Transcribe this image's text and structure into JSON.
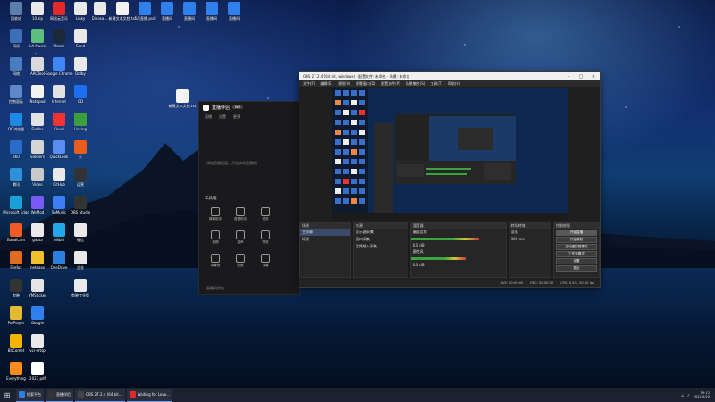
{
  "desktop": {
    "icons_col1": [
      {
        "label": "回收站",
        "color": "#5a7fa8"
      },
      {
        "label": "网易",
        "color": "#3d6fb8"
      },
      {
        "label": "网络",
        "color": "#4c7cc0"
      },
      {
        "label": "控制面板",
        "color": "#5d8ac7"
      },
      {
        "label": "QQ浏览器",
        "color": "#1e88e5"
      },
      {
        "label": "360",
        "color": "#2c6cc9"
      },
      {
        "label": "腾讯",
        "color": "#2f8fd8"
      },
      {
        "label": "Microsoft Edge",
        "color": "#1aa1d9"
      },
      {
        "label": "Bandicam",
        "color": "#f05a24"
      },
      {
        "label": "Firefox",
        "color": "#e26a1f"
      },
      {
        "label": "剪映",
        "color": "#333333"
      },
      {
        "label": "PotPlayer",
        "color": "#e4b830"
      },
      {
        "label": "BitComet",
        "color": "#f4b400"
      },
      {
        "label": "Everything",
        "color": "#ff8c1a"
      }
    ],
    "icons_col2": [
      {
        "label": "10.zip",
        "color": "#e9e9e9"
      },
      {
        "label": "LX Music",
        "color": "#5cbf7c"
      },
      {
        "label": "ARCTool",
        "color": "#d9d9d9"
      },
      {
        "label": "Notepad",
        "color": "#f2f2f2"
      },
      {
        "label": "Firefox",
        "color": "#e2e2e2"
      },
      {
        "label": "Soldiers",
        "color": "#d5d5d5"
      },
      {
        "label": "Video",
        "color": "#c9c9c9"
      },
      {
        "label": "WeMod",
        "color": "#7a5af5"
      },
      {
        "label": "gdata",
        "color": "#eaeaea"
      },
      {
        "label": "netease",
        "color": "#f2c02a"
      },
      {
        "label": "YMSticker",
        "color": "#e4e4e4"
      },
      {
        "label": "Google",
        "color": "#2f80ed"
      },
      {
        "label": "vcr+rtsp",
        "color": "#e9e9e9"
      },
      {
        "label": "2023.pdf",
        "color": "#ffffff"
      }
    ],
    "icons_col3": [
      {
        "label": "网易云音乐",
        "color": "#e22828"
      },
      {
        "label": "Steam",
        "color": "#1b2838"
      },
      {
        "label": "Google Chrome",
        "color": "#4285f4"
      },
      {
        "label": "Internet",
        "color": "#e2e2e2"
      },
      {
        "label": "Cloud",
        "color": "#e33"
      },
      {
        "label": "QuickLook",
        "color": "#5a8dee"
      },
      {
        "label": "GitHub",
        "color": "#e9e9e9"
      },
      {
        "label": "SoMusic",
        "color": "#3d7ef5"
      },
      {
        "label": "bilibili",
        "color": "#22a8e8"
      },
      {
        "label": "OneDrive",
        "color": "#2d7fe0"
      }
    ],
    "icons_col4": [
      {
        "label": "Linky",
        "color": "#e9e9e9"
      },
      {
        "label": "Send",
        "color": "#e9e9e9"
      },
      {
        "label": "Dolby",
        "color": "#e9e9e9"
      },
      {
        "label": "GD",
        "color": "#1e6ff0"
      },
      {
        "label": "Linking",
        "color": "#3c9e3c"
      },
      {
        "label": "火",
        "color": "#e85d1d"
      },
      {
        "label": "运营",
        "color": "#333"
      },
      {
        "label": "OBS Studio",
        "color": "#333"
      },
      {
        "label": "微信",
        "color": "#e9e9e9"
      },
      {
        "label": "企业",
        "color": "#e9e9e9"
      },
      {
        "label": "剪映专业版",
        "color": "#e9e9e9"
      }
    ],
    "top_files": [
      {
        "label": "Dinosa....",
        "color": "#e9e9e9"
      },
      {
        "label": "新建文本文档.txt",
        "color": "#f3f3f3"
      },
      {
        "label": "5月直播.psd",
        "color": "#2f80ed"
      },
      {
        "label": "直播间",
        "color": "#2f80ed"
      },
      {
        "label": "直播间",
        "color": "#2f80ed"
      },
      {
        "label": "直播间",
        "color": "#2f80ed"
      },
      {
        "label": "直播间",
        "color": "#2f80ed"
      }
    ],
    "floating_file": {
      "label": "新建文本文档.txt"
    }
  },
  "liveapp": {
    "title": "直播伴侣",
    "badge": "WS",
    "tabs": [
      "直播",
      "设置",
      "更多"
    ],
    "hint": "添加直播画面，开始你的直播吧",
    "section": "工具箱",
    "tools": [
      "弹幕助手",
      "语音助手",
      "任务",
      "美颜",
      "变声",
      "特效",
      "背景音",
      "拍照",
      "字幕"
    ],
    "footer": "直播间状态"
  },
  "obs": {
    "title": "OBS 27.2.4 (64 bit, windows) - 配置文件: 未命名 - 场景: 未命名",
    "menu": [
      "文件(F)",
      "编辑(E)",
      "视图(V)",
      "停靠窗口(D)",
      "配置文件(P)",
      "场景集合(S)",
      "工具(T)",
      "帮助(H)"
    ],
    "panels": {
      "scenes_header": "场景",
      "scenes": [
        "主屏幕",
        "场景"
      ],
      "sources_header": "来源",
      "sources": [
        "显示器采集",
        "窗口采集",
        "音频输入采集"
      ],
      "mixer_header": "混音器",
      "mixer_tracks": [
        {
          "name": "桌面音频",
          "level": "0.0 dB",
          "fill": 0.72
        },
        {
          "name": "麦克风",
          "level": "0.0 dB",
          "fill": 0.58
        }
      ],
      "transitions_header": "转场特效",
      "transition": "淡出",
      "duration": "300 ms",
      "controls_header": "控制按钮",
      "controls": [
        "开始直播",
        "开始录制",
        "启动虚拟摄像机",
        "工作室模式",
        "设置",
        "退出"
      ]
    },
    "status": [
      "LIVE: 00:00:00",
      "REC: 00:00:00",
      "CPU: 0.4%, 30.00 fps"
    ]
  },
  "taskbar": {
    "items": [
      {
        "label": "搜索平台",
        "color": "#2d7fe0"
      },
      {
        "label": "直播伴侣",
        "color": "#333"
      },
      {
        "label": "OBS 27.2.4 (64 bit...",
        "color": "#444"
      },
      {
        "label": "Waiting for Love...",
        "color": "#e22828"
      }
    ],
    "time": "19:12",
    "date": "2022/4/20"
  }
}
